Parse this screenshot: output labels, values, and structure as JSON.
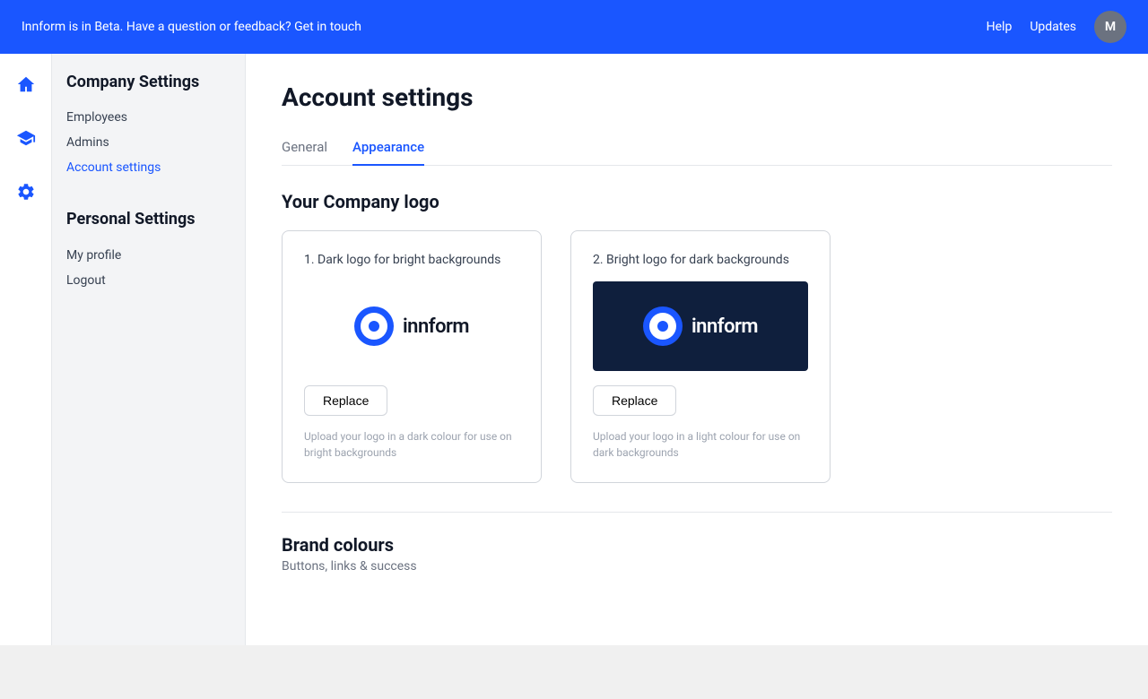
{
  "banner": {
    "text": "Innform is in Beta. Have a question or feedback? Get in touch",
    "help_label": "Help",
    "updates_label": "Updates",
    "avatar_initial": "M"
  },
  "icon_sidebar": {
    "home_icon": "home",
    "graduation_icon": "graduation",
    "gear_icon": "gear"
  },
  "nav": {
    "company_settings_title": "Company Settings",
    "company_items": [
      {
        "label": "Employees",
        "active": false
      },
      {
        "label": "Admins",
        "active": false
      },
      {
        "label": "Account settings",
        "active": true
      }
    ],
    "personal_settings_title": "Personal Settings",
    "personal_items": [
      {
        "label": "My profile",
        "active": false
      },
      {
        "label": "Logout",
        "active": false
      }
    ]
  },
  "main": {
    "page_title": "Account settings",
    "tabs": [
      {
        "label": "General",
        "active": false
      },
      {
        "label": "Appearance",
        "active": true
      }
    ],
    "logo_section_title": "Your Company logo",
    "logo_cards": [
      {
        "label": "1. Dark logo for bright backgrounds",
        "theme": "light",
        "replace_label": "Replace",
        "hint": "Upload your logo in a dark colour for use on bright backgrounds"
      },
      {
        "label": "2. Bright logo for dark backgrounds",
        "theme": "dark",
        "replace_label": "Replace",
        "hint": "Upload your logo in a light colour for use on dark backgrounds"
      }
    ],
    "brand_section_title": "Brand colours",
    "brand_section_sub": "Buttons, links & success"
  }
}
